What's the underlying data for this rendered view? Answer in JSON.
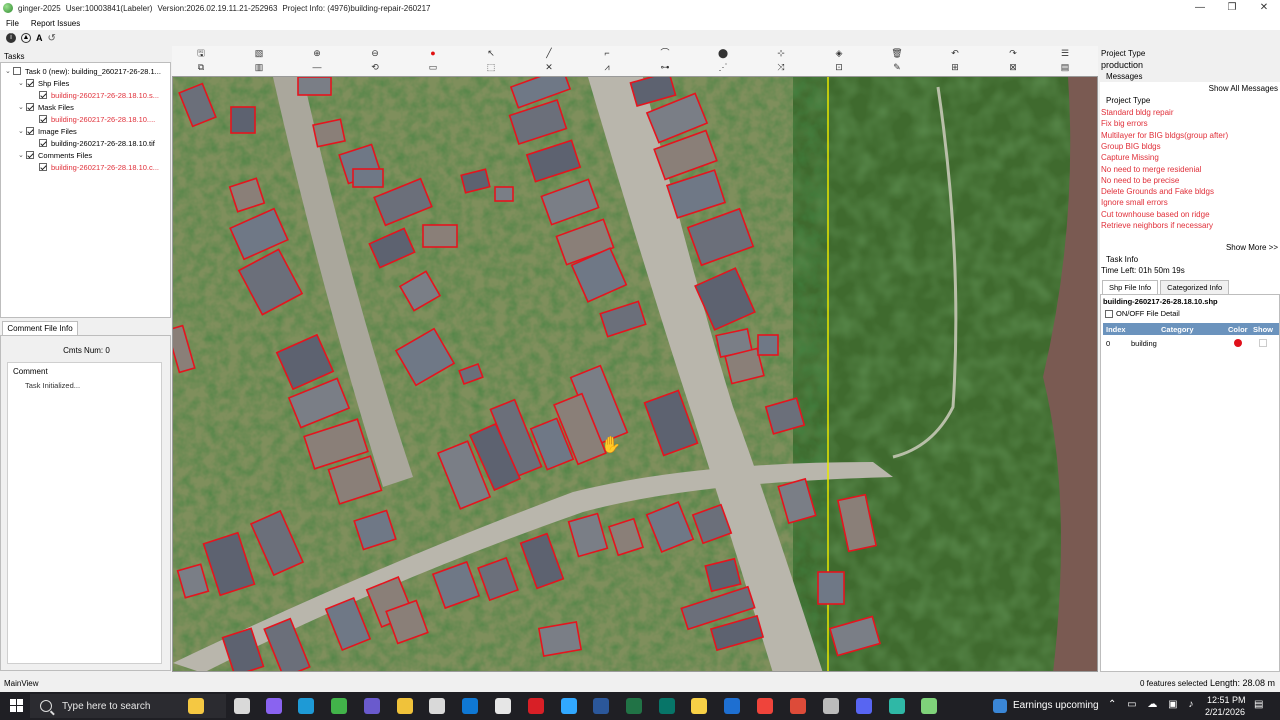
{
  "window": {
    "app_name": "ginger-2025",
    "user": "User:10003841(Labeler)",
    "version": "Version:2026.02.19.11.21-252963",
    "project_info": "Project Info: (4976)building-repair-260217",
    "controls": [
      "—",
      "❐",
      "✕"
    ]
  },
  "menu": [
    "File",
    "Report Issues"
  ],
  "small_toolbar_icons": [
    "info-icon",
    "up-icon",
    "text-icon",
    "refresh-icon"
  ],
  "tasks": {
    "label": "Tasks",
    "tree": [
      {
        "text": "Task 0 (new): building_260217-26-28.1...",
        "level": 0,
        "checked": false,
        "expand": true,
        "red": false
      },
      {
        "text": "Shp Files",
        "level": 1,
        "checked": true,
        "expand": true,
        "red": false
      },
      {
        "text": "building-260217-26-28.18.10.s...",
        "level": 2,
        "checked": true,
        "expand": false,
        "red": true
      },
      {
        "text": "Mask Files",
        "level": 1,
        "checked": true,
        "expand": true,
        "red": false
      },
      {
        "text": "building-260217-26-28.18.10....",
        "level": 2,
        "checked": true,
        "expand": false,
        "red": true
      },
      {
        "text": "Image Files",
        "level": 1,
        "checked": true,
        "expand": true,
        "red": false
      },
      {
        "text": "building-260217-26-28.18.10.tif",
        "level": 2,
        "checked": true,
        "expand": false,
        "red": false
      },
      {
        "text": "Comments Files",
        "level": 1,
        "checked": true,
        "expand": true,
        "red": false
      },
      {
        "text": "building-260217-26-28.18.10.c...",
        "level": 2,
        "checked": true,
        "expand": false,
        "red": true
      }
    ]
  },
  "comment_panel": {
    "tab": "Comment File Info",
    "count_label": "Cmts Num:  0",
    "column_header": "Comment",
    "first_value": "Task Initialized..."
  },
  "right_panel": {
    "project_type_label": "Project Type",
    "project_type_value": "production",
    "messages_label": "Messages",
    "show_all": "Show All Messages",
    "message_heading": "Project Type",
    "messages": [
      "Standard bldg repair",
      "Fix big errors",
      "Multilayer for BIG bldgs(group after)",
      "Group BIG bldgs",
      "Capture Missing",
      "No need to merge residenial",
      "No need to be precise",
      "Delete Grounds and Fake bldgs",
      "Ignore small errors",
      "Cut townhouse based on ridge",
      "Retrieve neighbors if necessary"
    ],
    "show_more": "Show More >>",
    "task_info_label": "Task Info",
    "time_left": "Time Left: 01h 50m 19s",
    "tabs": [
      "Shp File Info",
      "Categorized Info"
    ],
    "shp_file": "building-260217-26-28.18.10.shp",
    "onoff_label": "ON/OFF File Detail",
    "table_headers": [
      "Index",
      "Category",
      "Color",
      "Show"
    ],
    "table_rows": [
      {
        "index": "0",
        "category": "building",
        "color": "#e0101a"
      }
    ]
  },
  "status": {
    "left": "MainView",
    "features": "0 features selected",
    "length": "Length: 28.08 m"
  },
  "taskbar": {
    "search_placeholder": "Type here to search",
    "weather": "Earnings upcoming",
    "time": "12:51 PM",
    "date": "2/21/2026",
    "notification_count": "1"
  },
  "colors": {
    "polygon": "#e5141e",
    "vertical_line": "#e8e800",
    "message_red": "#e0303a",
    "table_header": "#6b93bd"
  }
}
